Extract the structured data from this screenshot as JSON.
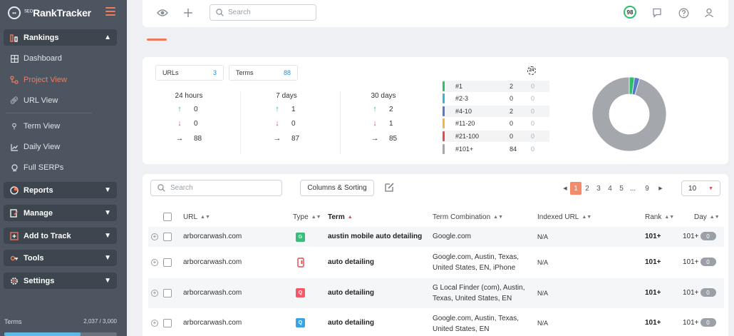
{
  "brand": {
    "name": "RankTracker",
    "prefix": "SEO"
  },
  "sidebar": {
    "sections": [
      {
        "label": "Rankings",
        "icon": "rankings-icon",
        "expanded": true
      },
      {
        "label": "Reports",
        "icon": "reports-icon"
      },
      {
        "label": "Manage",
        "icon": "manage-icon"
      },
      {
        "label": "Add to Track",
        "icon": "add-to-track-icon"
      },
      {
        "label": "Tools",
        "icon": "tools-icon"
      },
      {
        "label": "Settings",
        "icon": "settings-icon"
      }
    ],
    "items": [
      {
        "label": "Dashboard",
        "icon": "dashboard-icon"
      },
      {
        "label": "Project View",
        "icon": "project-view-icon",
        "active": true
      },
      {
        "label": "URL View",
        "icon": "link-icon"
      },
      {
        "label": "Term View",
        "icon": "term-view-icon"
      },
      {
        "label": "Daily View",
        "icon": "chart-icon"
      },
      {
        "label": "Full SERPs",
        "icon": "serp-icon"
      }
    ],
    "terms": {
      "label": "Terms",
      "value": "2,037 / 3,000",
      "used_fraction": 0.679
    }
  },
  "topbar": {
    "search_placeholder": "Search",
    "score": "98"
  },
  "summary": {
    "chips": [
      {
        "label": "URLs",
        "value": "3"
      },
      {
        "label": "Terms",
        "value": "88"
      }
    ],
    "periods": [
      {
        "label": "24 hours",
        "up": "0",
        "down": "0",
        "flat": "88"
      },
      {
        "label": "7 days",
        "up": "1",
        "down": "0",
        "flat": "87"
      },
      {
        "label": "30 days",
        "up": "2",
        "down": "1",
        "flat": "85"
      }
    ],
    "rank_icon_label": "24",
    "rank_buckets": [
      {
        "label": "#1",
        "value": "2",
        "change": "0",
        "color": "#2bbf6a"
      },
      {
        "label": "#2-3",
        "value": "0",
        "change": "0",
        "color": "#35b6d6"
      },
      {
        "label": "#4-10",
        "value": "2",
        "change": "0",
        "color": "#5a78c8"
      },
      {
        "label": "#11-20",
        "value": "0",
        "change": "0",
        "color": "#f4b63e"
      },
      {
        "label": "#21-100",
        "value": "0",
        "change": "0",
        "color": "#e5484d"
      },
      {
        "label": "#101+",
        "value": "84",
        "change": "0",
        "color": "#a4a8ad"
      }
    ]
  },
  "chart_data": {
    "type": "pie",
    "style": "donut",
    "categories": [
      "#1",
      "#2-3",
      "#4-10",
      "#11-20",
      "#21-100",
      "#101+"
    ],
    "values": [
      2,
      0,
      2,
      0,
      0,
      84
    ],
    "colors": [
      "#2bbf6a",
      "#35b6d6",
      "#5a78c8",
      "#f4b63e",
      "#e5484d",
      "#a4a8ad"
    ],
    "title": ""
  },
  "table": {
    "search_placeholder": "Search",
    "columns_button": "Columns & Sorting",
    "pagination": {
      "pages": [
        "1",
        "2",
        "3",
        "4",
        "5",
        "...",
        "9"
      ],
      "current": "1"
    },
    "per_page": "10",
    "headers": {
      "url": "URL",
      "type": "Type",
      "term": "Term",
      "combo": "Term Combination",
      "indexed": "Indexed URL",
      "rank": "Rank",
      "day": "Day"
    },
    "rows": [
      {
        "url": "arborcarwash.com",
        "type_icon": "google-icon",
        "type_color": "#3dbb7a",
        "type_glyph": "G",
        "term": "austin mobile auto detailing",
        "combo": [
          "Google.com"
        ],
        "indexed": "N/A",
        "rank": "101+",
        "day": "101+",
        "day_change": "0"
      },
      {
        "url": "arborcarwash.com",
        "type_icon": "mobile-icon",
        "type_color": "#e5484d",
        "type_glyph": "",
        "term": "auto detailing",
        "combo": [
          "Google.com, Austin, Texas,",
          "United States, EN, iPhone"
        ],
        "indexed": "N/A",
        "rank": "101+",
        "day": "101+",
        "day_change": "0"
      },
      {
        "url": "arborcarwash.com",
        "type_icon": "local-finder-icon",
        "type_color": "#f25a6b",
        "type_glyph": "Q",
        "term": "auto detailing",
        "combo": [
          "G Local Finder (com), Austin,",
          "Texas, United States, EN"
        ],
        "indexed": "N/A",
        "rank": "101+",
        "day": "101+",
        "day_change": "0"
      },
      {
        "url": "arborcarwash.com",
        "type_icon": "location-search-icon",
        "type_color": "#3aa3e0",
        "type_glyph": "Q",
        "term": "auto detailing",
        "combo": [
          "Google.com, Austin, Texas,",
          "United States, EN"
        ],
        "indexed": "N/A",
        "rank": "101+",
        "day": "101+",
        "day_change": "0"
      }
    ]
  }
}
